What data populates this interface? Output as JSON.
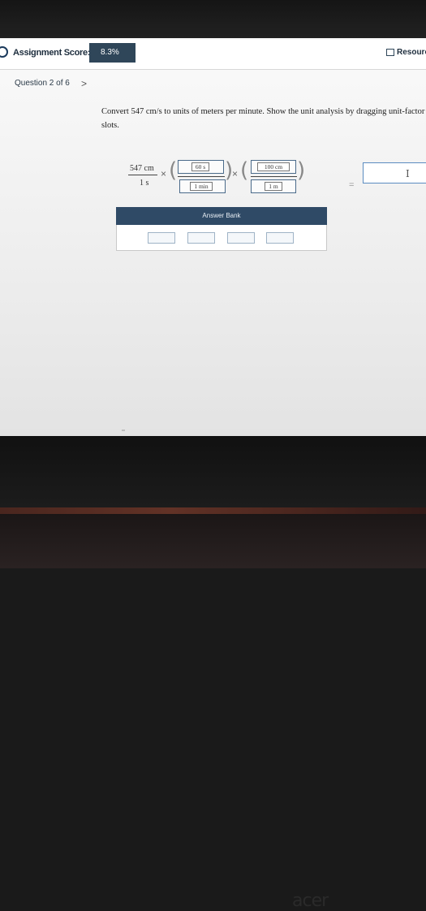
{
  "header": {
    "score_label": "Assignment Score:",
    "score_value": "8.3%",
    "resources_label": "Resourc"
  },
  "nav": {
    "question_label": "Question 2 of 6",
    "next_glyph": ">"
  },
  "question": {
    "prompt": "Convert 547 cm/s to units of meters per minute. Show the unit analysis by dragging unit-factor slots."
  },
  "equation": {
    "given_numerator": "547 cm",
    "given_denominator": "1 s",
    "times_glyph": "×",
    "factor1_numerator": "60 s",
    "factor1_denominator": "1 min",
    "factor2_numerator": "100 cm",
    "factor2_denominator": "1 m",
    "equals_glyph": "=",
    "cursor_glyph": "I"
  },
  "answer_bank": {
    "title": "Answer Bank",
    "slot_count": 4
  },
  "device": {
    "brand": "acer"
  }
}
